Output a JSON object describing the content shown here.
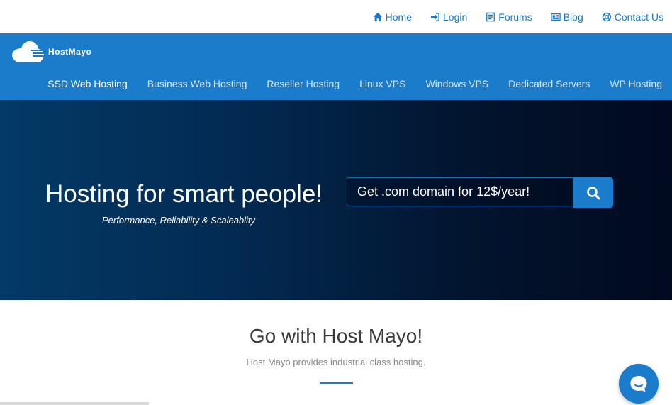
{
  "topbar": {
    "links": [
      {
        "label": "Home",
        "icon": "home-icon"
      },
      {
        "label": "Login",
        "icon": "login-icon"
      },
      {
        "label": "Forums",
        "icon": "forums-icon"
      },
      {
        "label": "Blog",
        "icon": "blog-icon"
      },
      {
        "label": "Contact Us",
        "icon": "support-icon"
      }
    ]
  },
  "brand": {
    "logo_text": "HostMayo"
  },
  "nav": {
    "items": [
      {
        "label": "SSD Web Hosting"
      },
      {
        "label": "Business Web Hosting"
      },
      {
        "label": "Reseller Hosting"
      },
      {
        "label": "Linux VPS"
      },
      {
        "label": "Windows VPS"
      },
      {
        "label": "Dedicated Servers"
      },
      {
        "label": "WP Hosting"
      }
    ]
  },
  "hero": {
    "title": "Hosting for smart people!",
    "subtitle": "Performance, Reliability & Scaleablity",
    "search_placeholder": "Get .com domain for 12$/year!"
  },
  "section": {
    "title": "Go with Host Mayo!",
    "subtitle": "Host Mayo provides industrial class hosting."
  },
  "colors": {
    "accent": "#1b7ccc",
    "link": "#1a7ac6",
    "hero_dark": "#010a1f"
  }
}
